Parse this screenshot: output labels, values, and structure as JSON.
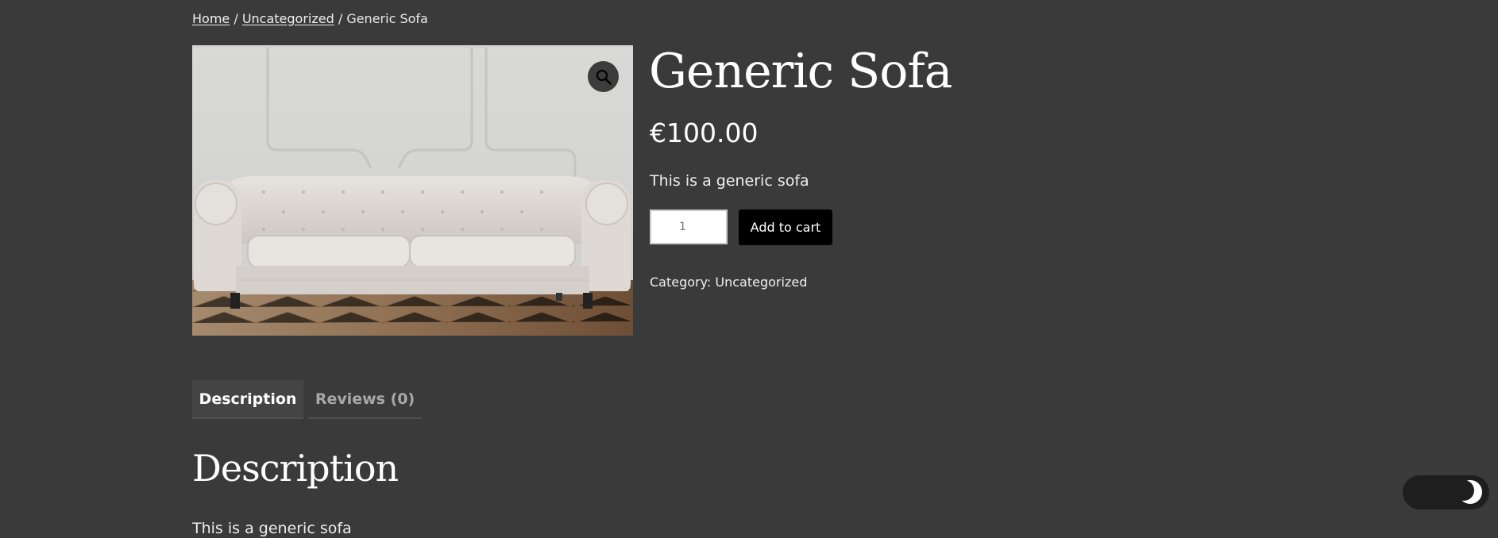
{
  "breadcrumb": {
    "home": "Home",
    "separator1": " / ",
    "category": "Uncategorized",
    "separator2": " / ",
    "current": "Generic Sofa"
  },
  "product": {
    "image_alt": "Generic Sofa",
    "title": "Generic Sofa",
    "price": "€100.00",
    "short_description": "This is a generic sofa",
    "quantity_value": "1",
    "add_to_cart_label": "Add to cart",
    "category_label": "Category:",
    "category_value": "Uncategorized"
  },
  "icons": {
    "zoom": "search-icon",
    "dark_mode": "moon-icon"
  },
  "tabs": [
    {
      "label": "Description",
      "active": true
    },
    {
      "label": "Reviews (0)",
      "active": false
    }
  ],
  "description_section": {
    "heading": "Description",
    "text": "This is a generic sofa"
  },
  "colors": {
    "page_background": "#3a3a3a",
    "button_background": "#000000",
    "text": "#ffffff",
    "toggle_background": "#1e1e1e"
  }
}
